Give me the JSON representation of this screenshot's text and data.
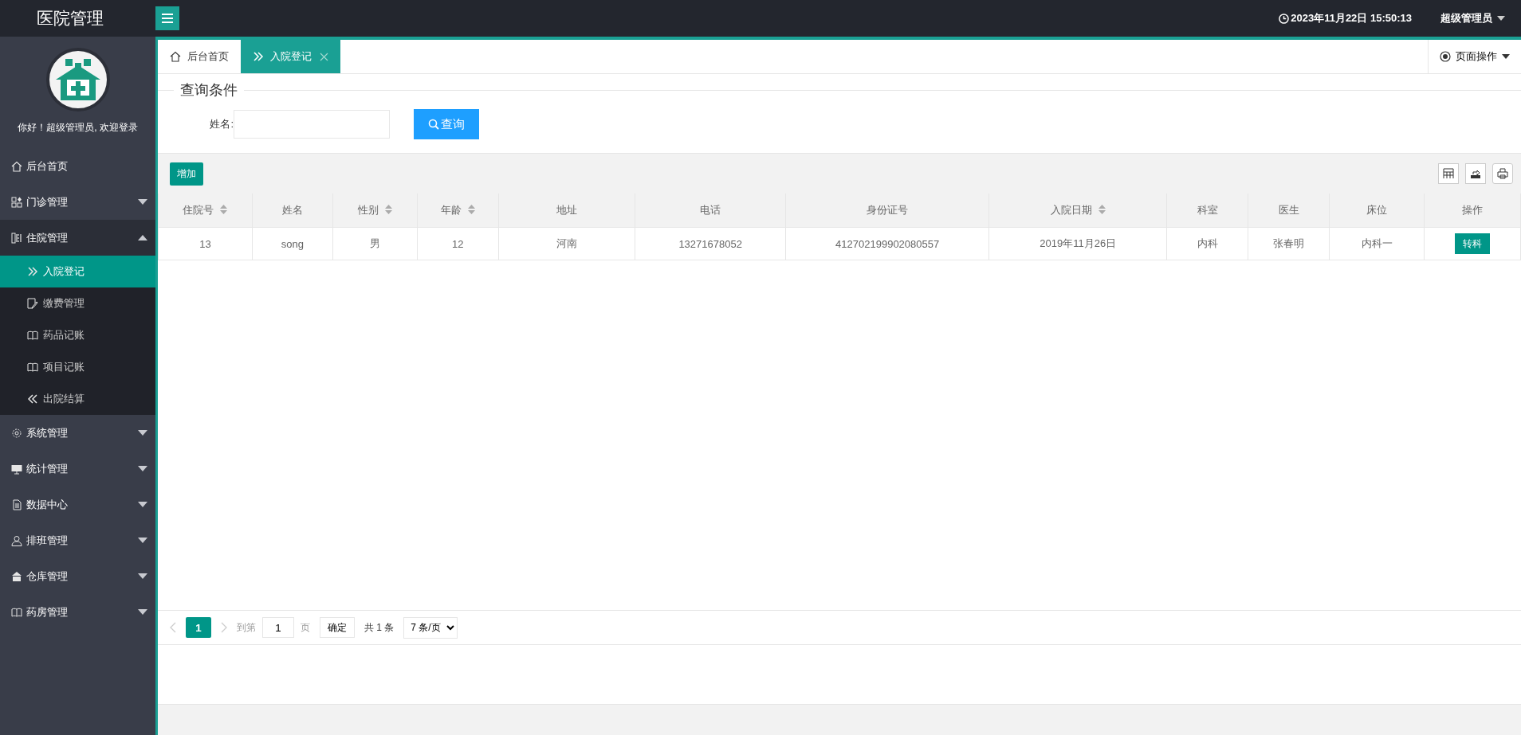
{
  "header": {
    "title": "医院管理",
    "datetime": "2023年11月22日 15:50:13",
    "user": "超级管理员"
  },
  "sidebar": {
    "greeting": "你好！超级管理员, 欢迎登录",
    "items": [
      {
        "label": "后台首页",
        "kind": "home",
        "selected": false
      },
      {
        "label": "门诊管理",
        "kind": "apps",
        "selected": false,
        "expanded": false
      },
      {
        "label": "住院管理",
        "kind": "columns",
        "selected": false,
        "expanded": true,
        "children": [
          {
            "label": "入院登记",
            "kind": "forward",
            "selected": true
          },
          {
            "label": "缴费管理",
            "kind": "edit",
            "selected": false
          },
          {
            "label": "药品记账",
            "kind": "book",
            "selected": false
          },
          {
            "label": "项目记账",
            "kind": "book",
            "selected": false
          },
          {
            "label": "出院结算",
            "kind": "back",
            "selected": false
          }
        ]
      },
      {
        "label": "系统管理",
        "kind": "gear",
        "selected": false,
        "expanded": false
      },
      {
        "label": "统计管理",
        "kind": "monitor",
        "selected": false,
        "expanded": false
      },
      {
        "label": "数据中心",
        "kind": "doc",
        "selected": false,
        "expanded": false
      },
      {
        "label": "排班管理",
        "kind": "user",
        "selected": false,
        "expanded": false
      },
      {
        "label": "仓库管理",
        "kind": "store",
        "selected": false,
        "expanded": false
      },
      {
        "label": "药房管理",
        "kind": "book",
        "selected": false,
        "expanded": false
      }
    ]
  },
  "tabs": [
    {
      "label": "后台首页",
      "kind": "home",
      "selected": false,
      "closable": false
    },
    {
      "label": "入院登记",
      "kind": "forward",
      "selected": true,
      "closable": true
    }
  ],
  "page_actions": "页面操作",
  "query": {
    "legend": "查询条件",
    "field_label": "姓名:",
    "button": "查询"
  },
  "toolbar": {
    "add_button": "增加"
  },
  "table": {
    "columns": [
      {
        "label": "住院号",
        "sortable": true
      },
      {
        "label": "姓名",
        "sortable": false
      },
      {
        "label": "性别",
        "sortable": true
      },
      {
        "label": "年龄",
        "sortable": true
      },
      {
        "label": "地址",
        "sortable": false
      },
      {
        "label": "电话",
        "sortable": false
      },
      {
        "label": "身份证号",
        "sortable": false
      },
      {
        "label": "入院日期",
        "sortable": true
      },
      {
        "label": "科室",
        "sortable": false
      },
      {
        "label": "医生",
        "sortable": false
      },
      {
        "label": "床位",
        "sortable": false
      },
      {
        "label": "操作",
        "sortable": false
      }
    ],
    "rows": [
      {
        "cells": [
          "13",
          "song",
          "男",
          "12",
          "河南",
          "13271678052",
          "412702199902080557",
          "2019年11月26日",
          "内科",
          "张春明",
          "内科一"
        ],
        "action": "转科"
      }
    ]
  },
  "pagination": {
    "pages": [
      {
        "label": "1",
        "selected": true
      }
    ],
    "goto_label": "到第",
    "goto_value": "1",
    "page_unit": "页",
    "confirm": "确定",
    "total": "共 1 条",
    "page_size": "7 条/页"
  }
}
